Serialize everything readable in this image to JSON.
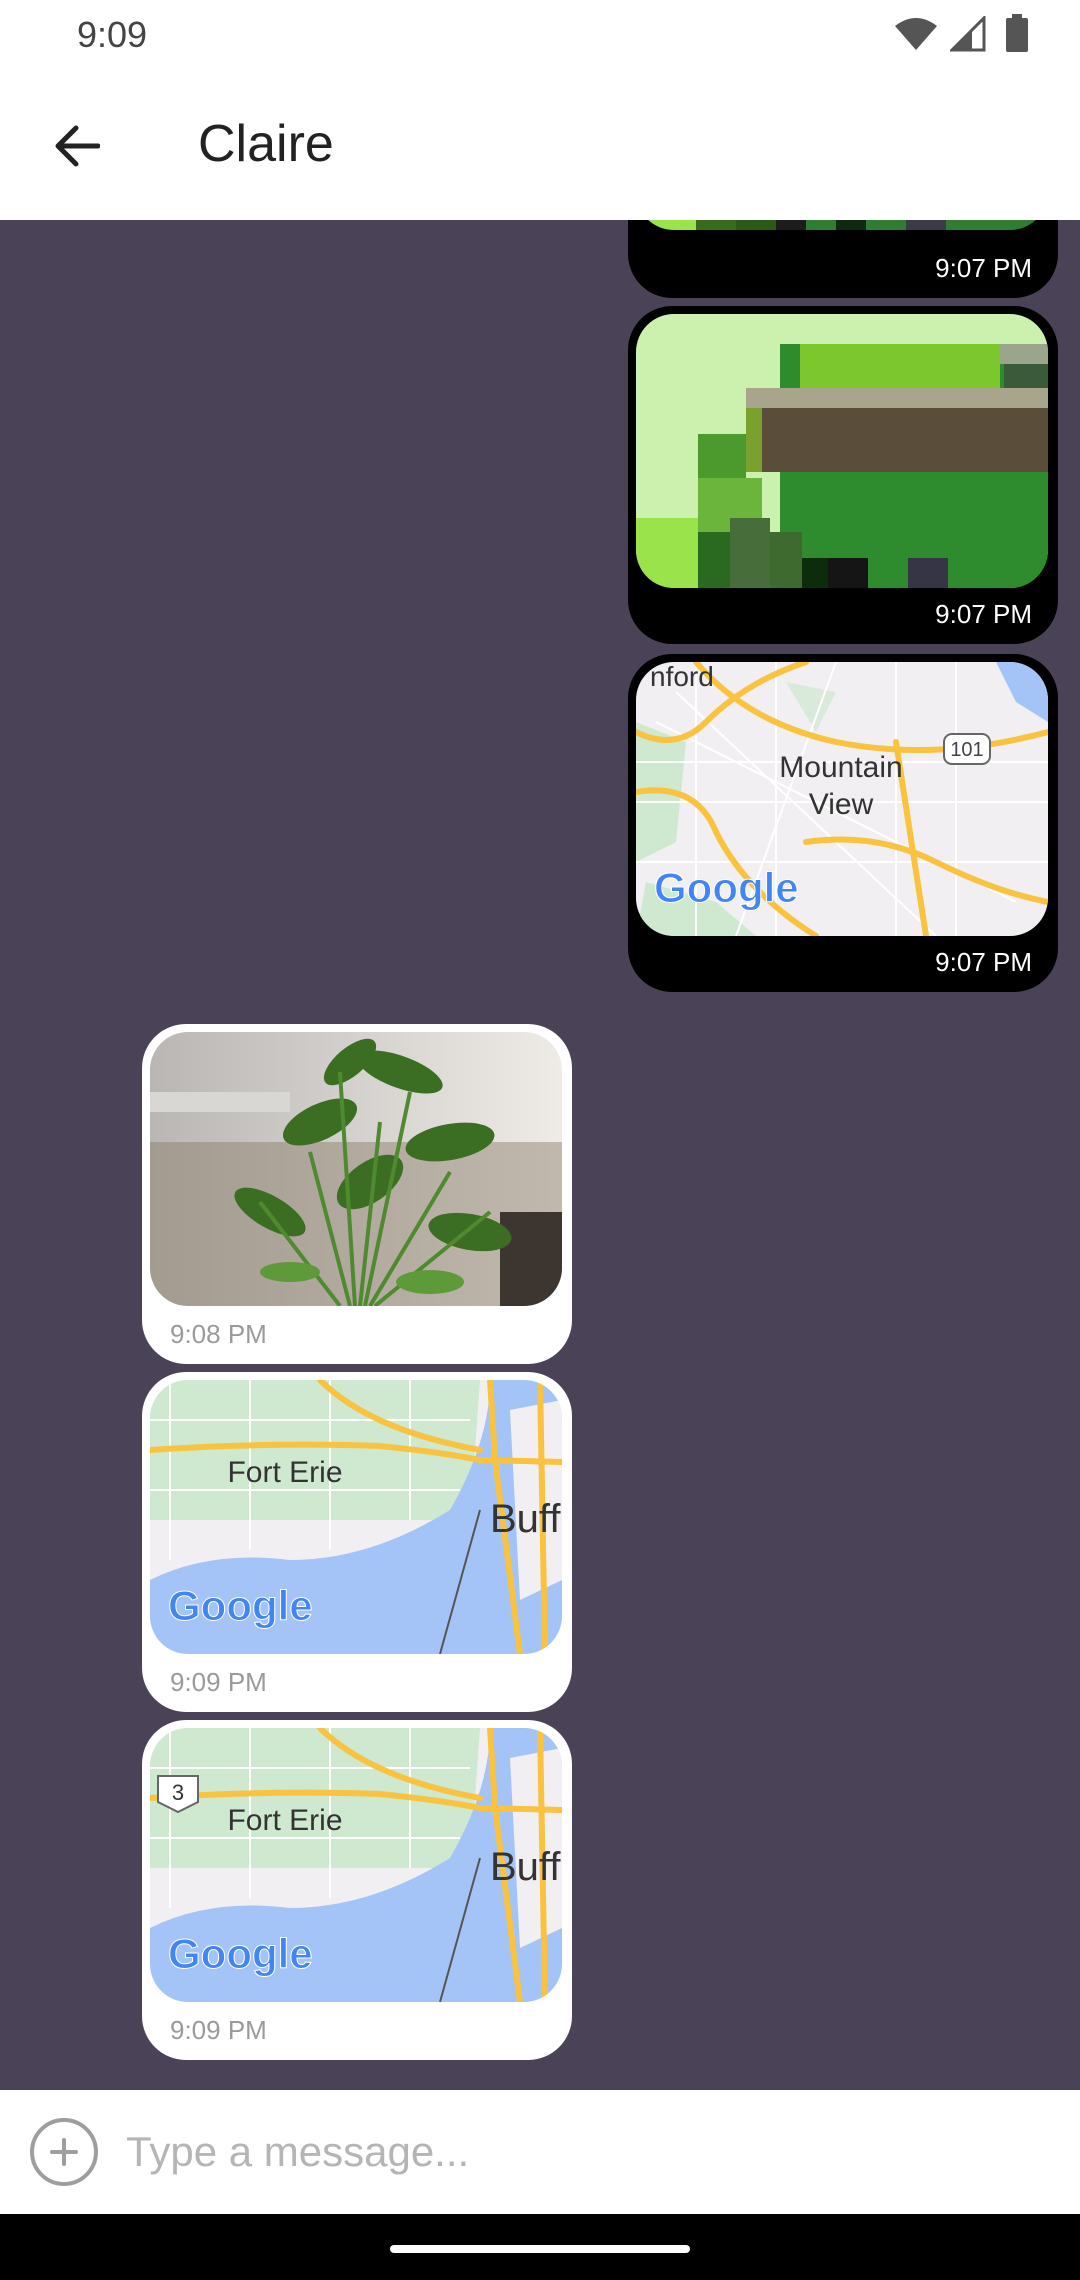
{
  "status_bar": {
    "time": "9:09",
    "icons": [
      "wifi-icon",
      "cellular-signal-icon",
      "battery-icon"
    ]
  },
  "app_bar": {
    "title": "Claire",
    "back_icon": "arrow-back-icon"
  },
  "messages": [
    {
      "direction": "outgoing",
      "kind": "image",
      "time": "9:07 PM"
    },
    {
      "direction": "outgoing",
      "kind": "image",
      "time": "9:07 PM"
    },
    {
      "direction": "outgoing",
      "kind": "map",
      "time": "9:07 PM",
      "map_labels": {
        "place_1": "nford",
        "place_2": "Mountain",
        "place_3": "View",
        "highway": "101",
        "brand": "Google"
      }
    },
    {
      "direction": "incoming",
      "kind": "image",
      "time": "9:08 PM"
    },
    {
      "direction": "incoming",
      "kind": "map",
      "time": "9:09 PM",
      "map_labels": {
        "place_1": "Fort Erie",
        "place_2": "Buff",
        "brand": "Google"
      }
    },
    {
      "direction": "incoming",
      "kind": "map",
      "time": "9:09 PM",
      "map_labels": {
        "place_1": "Fort Erie",
        "place_2": "Buff",
        "route": "3",
        "brand": "Google"
      }
    }
  ],
  "composer": {
    "placeholder": "Type a message...",
    "add_icon": "add-circle-icon"
  },
  "colors": {
    "chat_background": "#4a4257",
    "outgoing_bubble": "#000000",
    "incoming_bubble": "#ffffff",
    "map_water": "#a4c4f8",
    "map_highway": "#f9c33f"
  }
}
